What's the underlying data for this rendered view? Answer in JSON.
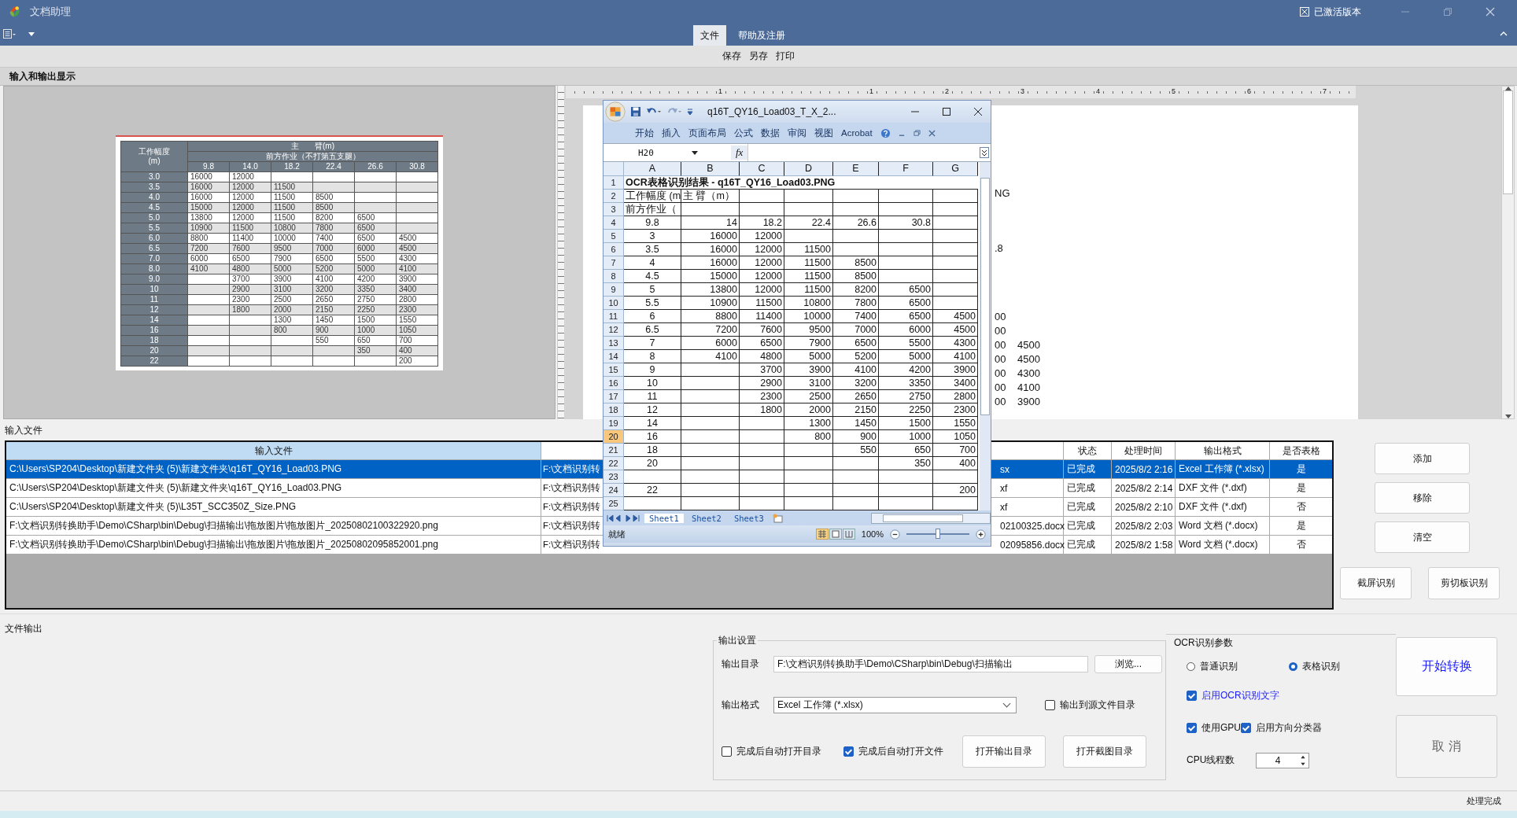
{
  "window": {
    "title": "文档助理",
    "activation": "已激活版本"
  },
  "ribbon": {
    "tabs": [
      {
        "label": "文件",
        "selected": true
      },
      {
        "label": "帮助及注册",
        "selected": false
      }
    ],
    "commands": [
      "保存",
      "另存",
      "打印"
    ]
  },
  "display": {
    "title": "输入和输出显示",
    "preview_table": {
      "corner": "工作幅度",
      "corner_unit": "(m)",
      "group": "主　　臂(m)",
      "subgroup": "前方作业（不打第五支腿）",
      "columns": [
        "9.8",
        "14.0",
        "18.2",
        "22.4",
        "26.6",
        "30.8"
      ],
      "rows": [
        {
          "label": "3.0",
          "cells": [
            "16000",
            "12000",
            null,
            null,
            null,
            null
          ]
        },
        {
          "label": "3.5",
          "cells": [
            "16000",
            "12000",
            "11500",
            null,
            null,
            null
          ]
        },
        {
          "label": "4.0",
          "cells": [
            "16000",
            "12000",
            "11500",
            "8500",
            null,
            null
          ]
        },
        {
          "label": "4.5",
          "cells": [
            "15000",
            "12000",
            "11500",
            "8500",
            null,
            null
          ]
        },
        {
          "label": "5.0",
          "cells": [
            "13800",
            "12000",
            "11500",
            "8200",
            "6500",
            null
          ]
        },
        {
          "label": "5.5",
          "cells": [
            "10900",
            "11500",
            "10800",
            "7800",
            "6500",
            null
          ]
        },
        {
          "label": "6.0",
          "cells": [
            "8800",
            "11400",
            "10000",
            "7400",
            "6500",
            "4500"
          ]
        },
        {
          "label": "6.5",
          "cells": [
            "7200",
            "7600",
            "9500",
            "7000",
            "6000",
            "4500"
          ]
        },
        {
          "label": "7.0",
          "cells": [
            "6000",
            "6500",
            "7900",
            "6500",
            "5500",
            "4300"
          ]
        },
        {
          "label": "8.0",
          "cells": [
            "4100",
            "4800",
            "5000",
            "5200",
            "5000",
            "4100"
          ]
        },
        {
          "label": "9.0",
          "cells": [
            null,
            "3700",
            "3900",
            "4100",
            "4200",
            "3900"
          ]
        },
        {
          "label": "10",
          "cells": [
            null,
            "2900",
            "3100",
            "3200",
            "3350",
            "3400"
          ]
        },
        {
          "label": "11",
          "cells": [
            null,
            "2300",
            "2500",
            "2650",
            "2750",
            "2800"
          ]
        },
        {
          "label": "12",
          "cells": [
            null,
            "1800",
            "2000",
            "2150",
            "2250",
            "2300"
          ]
        },
        {
          "label": "14",
          "cells": [
            null,
            null,
            "1300",
            "1450",
            "1500",
            "1550"
          ]
        },
        {
          "label": "16",
          "cells": [
            null,
            null,
            "800",
            "900",
            "1000",
            "1050"
          ]
        },
        {
          "label": "18",
          "cells": [
            null,
            null,
            null,
            "550",
            "650",
            "700"
          ]
        },
        {
          "label": "20",
          "cells": [
            null,
            null,
            null,
            null,
            "350",
            "400"
          ]
        },
        {
          "label": "22",
          "cells": [
            null,
            null,
            null,
            null,
            null,
            "200"
          ]
        }
      ]
    },
    "ruler": [
      "1",
      "1",
      "2",
      "3",
      "4",
      "5",
      "6",
      "7"
    ],
    "document_fragments": [
      {
        "cells": [
          "NG"
        ]
      },
      {
        "cells": [
          ".8"
        ]
      },
      {
        "cells": [
          "00"
        ]
      },
      {
        "cells": [
          "00"
        ]
      },
      {
        "cells": [
          "00",
          "4500"
        ]
      },
      {
        "cells": [
          "00",
          "4500"
        ]
      },
      {
        "cells": [
          "00",
          "4300"
        ]
      },
      {
        "cells": [
          "00",
          "4100"
        ]
      },
      {
        "cells": [
          "00",
          "3900"
        ]
      }
    ]
  },
  "excel": {
    "title": "q16T_QY16_Load03_T_X_2...",
    "tabs": [
      "开始",
      "插入",
      "页面布局",
      "公式",
      "数据",
      "审阅",
      "视图",
      "Acrobat"
    ],
    "name_box": "H20",
    "fx": "fx",
    "columns": [
      "A",
      "B",
      "C",
      "D",
      "E",
      "F",
      "G"
    ],
    "rows": [
      {
        "num": "1",
        "selected": false,
        "cells": [
          "OCR表格识别结果 - q16T_QY16_Load03.PNG",
          null,
          null,
          null,
          null,
          null,
          null
        ]
      },
      {
        "num": "2",
        "selected": false,
        "cells": [
          "工作幅度 (m",
          "主 臂（m）",
          null,
          null,
          null,
          null,
          null
        ]
      },
      {
        "num": "3",
        "selected": false,
        "cells": [
          "前方作业（",
          null,
          null,
          null,
          null,
          null,
          null
        ]
      },
      {
        "num": "4",
        "selected": false,
        "cells": [
          "9.8",
          "14",
          "18.2",
          "22.4",
          "26.6",
          "30.8",
          null
        ]
      },
      {
        "num": "5",
        "selected": false,
        "cells": [
          "3",
          "16000",
          "12000",
          null,
          null,
          null,
          null
        ]
      },
      {
        "num": "6",
        "selected": false,
        "cells": [
          "3.5",
          "16000",
          "12000",
          "11500",
          null,
          null,
          null
        ]
      },
      {
        "num": "7",
        "selected": false,
        "cells": [
          "4",
          "16000",
          "12000",
          "11500",
          "8500",
          null,
          null
        ]
      },
      {
        "num": "8",
        "selected": false,
        "cells": [
          "4.5",
          "15000",
          "12000",
          "11500",
          "8500",
          null,
          null
        ]
      },
      {
        "num": "9",
        "selected": false,
        "cells": [
          "5",
          "13800",
          "12000",
          "11500",
          "8200",
          "6500",
          null
        ]
      },
      {
        "num": "10",
        "selected": false,
        "cells": [
          "5.5",
          "10900",
          "11500",
          "10800",
          "7800",
          "6500",
          null
        ]
      },
      {
        "num": "11",
        "selected": false,
        "cells": [
          "6",
          "8800",
          "11400",
          "10000",
          "7400",
          "6500",
          "4500"
        ]
      },
      {
        "num": "12",
        "selected": false,
        "cells": [
          "6.5",
          "7200",
          "7600",
          "9500",
          "7000",
          "6000",
          "4500"
        ]
      },
      {
        "num": "13",
        "selected": false,
        "cells": [
          "7",
          "6000",
          "6500",
          "7900",
          "6500",
          "5500",
          "4300"
        ]
      },
      {
        "num": "14",
        "selected": false,
        "cells": [
          "8",
          "4100",
          "4800",
          "5000",
          "5200",
          "5000",
          "4100"
        ]
      },
      {
        "num": "15",
        "selected": false,
        "cells": [
          "9",
          null,
          "3700",
          "3900",
          "4100",
          "4200",
          "3900"
        ]
      },
      {
        "num": "16",
        "selected": false,
        "cells": [
          "10",
          null,
          "2900",
          "3100",
          "3200",
          "3350",
          "3400"
        ]
      },
      {
        "num": "17",
        "selected": false,
        "cells": [
          "11",
          null,
          "2300",
          "2500",
          "2650",
          "2750",
          "2800"
        ]
      },
      {
        "num": "18",
        "selected": false,
        "cells": [
          "12",
          null,
          "1800",
          "2000",
          "2150",
          "2250",
          "2300"
        ]
      },
      {
        "num": "19",
        "selected": false,
        "cells": [
          "14",
          null,
          null,
          "1300",
          "1450",
          "1500",
          "1550"
        ]
      },
      {
        "num": "20",
        "selected": true,
        "cells": [
          "16",
          null,
          null,
          "800",
          "900",
          "1000",
          "1050"
        ]
      },
      {
        "num": "21",
        "selected": false,
        "cells": [
          "18",
          null,
          null,
          null,
          "550",
          "650",
          "700"
        ]
      },
      {
        "num": "22",
        "selected": false,
        "cells": [
          "20",
          null,
          null,
          null,
          null,
          "350",
          "400"
        ]
      },
      {
        "num": "23",
        "selected": false,
        "cells": [
          null,
          null,
          null,
          null,
          null,
          null,
          null
        ]
      },
      {
        "num": "24",
        "selected": false,
        "cells": [
          "22",
          null,
          null,
          null,
          null,
          null,
          "200"
        ]
      },
      {
        "num": "25",
        "selected": false,
        "cells": [
          null,
          null,
          null,
          null,
          null,
          null,
          null
        ]
      }
    ],
    "sheets": [
      {
        "label": "Sheet1",
        "selected": true
      },
      {
        "label": "Sheet2",
        "selected": false
      },
      {
        "label": "Sheet3",
        "selected": false
      }
    ],
    "status": "就绪",
    "zoom": "100%",
    "zoom_slider": {
      "level": 0.5
    }
  },
  "input_files": {
    "title": "输入文件",
    "columns": [
      "输入文件",
      "状态",
      "处理时间",
      "输出格式",
      "是否表格"
    ],
    "rows": [
      {
        "selected": true,
        "input": "C:\\Users\\SP204\\Desktop\\新建文件夹 (5)\\新建文件夹\\q16T_QY16_Load03.PNG",
        "output_start": "F:\\文档识别转",
        "output_end": "sx",
        "status": "已完成",
        "time": "2025/8/2 2:16",
        "format": "Excel 工作簿 (*.xlsx)",
        "is_table": "是"
      },
      {
        "selected": false,
        "input": "C:\\Users\\SP204\\Desktop\\新建文件夹 (5)\\新建文件夹\\q16T_QY16_Load03.PNG",
        "output_start": "F:\\文档识别转",
        "output_end": "xf",
        "status": "已完成",
        "time": "2025/8/2 2:14",
        "format": "DXF 文件 (*.dxf)",
        "is_table": "是"
      },
      {
        "selected": false,
        "input": "C:\\Users\\SP204\\Desktop\\新建文件夹 (5)\\L35T_SCC350Z_Size.PNG",
        "output_start": "F:\\文档识别转",
        "output_end": "xf",
        "status": "已完成",
        "time": "2025/8/2 2:10",
        "format": "DXF 文件 (*.dxf)",
        "is_table": "否"
      },
      {
        "selected": false,
        "input": "F:\\文档识别转换助手\\Demo\\CSharp\\bin\\Debug\\扫描输出\\拖放图片\\拖放图片_20250802100322920.png",
        "output_start": "F:\\文档识别转",
        "output_end": "02100325.docx",
        "status": "已完成",
        "time": "2025/8/2 2:03",
        "format": "Word 文档 (*.docx)",
        "is_table": "是"
      },
      {
        "selected": false,
        "input": "F:\\文档识别转换助手\\Demo\\CSharp\\bin\\Debug\\扫描输出\\拖放图片\\拖放图片_20250802095852001.png",
        "output_start": "F:\\文档识别转",
        "output_end": "02095856.docx",
        "status": "已完成",
        "time": "2025/8/2 1:58",
        "format": "Word 文档 (*.docx)",
        "is_table": "否"
      }
    ],
    "buttons": [
      "添加",
      "移除",
      "清空"
    ],
    "capture_buttons": [
      "截屏识别",
      "剪切板识别"
    ]
  },
  "file_output": {
    "title": "文件输出",
    "settings": {
      "title": "输出设置",
      "dir_label": "输出目录",
      "dir_value": "F:\\文档识别转换助手\\Demo\\CSharp\\bin\\Debug\\扫描输出",
      "browse": "浏览...",
      "format_label": "输出格式",
      "format_value": "Excel 工作簿 (*.xlsx)",
      "to_source": {
        "label": "输出到源文件目录",
        "checked": false
      },
      "open_dir": {
        "label": "完成后自动打开目录",
        "checked": false
      },
      "open_file": {
        "label": "完成后自动打开文件",
        "checked": true
      },
      "buttons": [
        "打开输出目录",
        "打开截图目录"
      ]
    },
    "ocr": {
      "title": "OCR识别参数",
      "modes": [
        {
          "label": "普通识别",
          "selected": false
        },
        {
          "label": "表格识别",
          "selected": true
        }
      ],
      "enable_ocr": {
        "label": "启用OCR识别文字",
        "checked": true
      },
      "gpu": {
        "label": "使用GPU",
        "checked": true
      },
      "orientation": {
        "label": "启用方向分类器",
        "checked": true
      },
      "threads_label": "CPU线程数",
      "threads": "4"
    },
    "start": "开始转换",
    "cancel": {
      "label": "取 消",
      "disabled": true
    }
  },
  "status_bar": "处理完成"
}
